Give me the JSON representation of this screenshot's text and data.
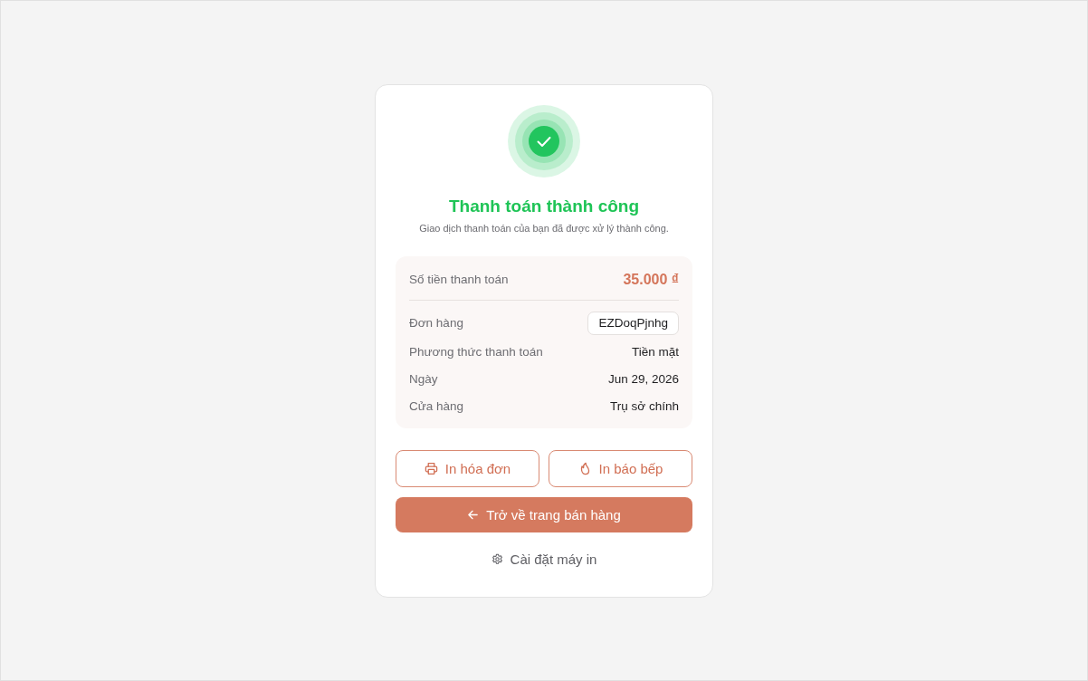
{
  "status": {
    "kind": "success",
    "title": "Thanh toán thành công",
    "message": "Giao dịch thanh toán của bạn đã được xử lý thành công."
  },
  "summary": {
    "amount": {
      "label": "Số tiền thanh toán",
      "value": "35.000 ₫"
    },
    "rows": [
      {
        "label": "Đơn hàng",
        "value": "EZDoqPjnhg",
        "kind": "badge"
      },
      {
        "label": "Phương thức thanh toán",
        "value": "Tiền mặt",
        "kind": "text"
      },
      {
        "label": "Ngày",
        "value": "Jun 29, 2026",
        "kind": "text"
      },
      {
        "label": "Cửa hàng",
        "value": "Trụ sở chính",
        "kind": "text"
      }
    ]
  },
  "actions": [
    {
      "label": "In hóa đơn",
      "kind": "outline"
    },
    {
      "label": "In báo bếp",
      "kind": "outline"
    },
    {
      "label": "Trở về trang bán hàng",
      "kind": "primary"
    }
  ],
  "settings_link": {
    "label": "Cài đặt máy in"
  }
}
